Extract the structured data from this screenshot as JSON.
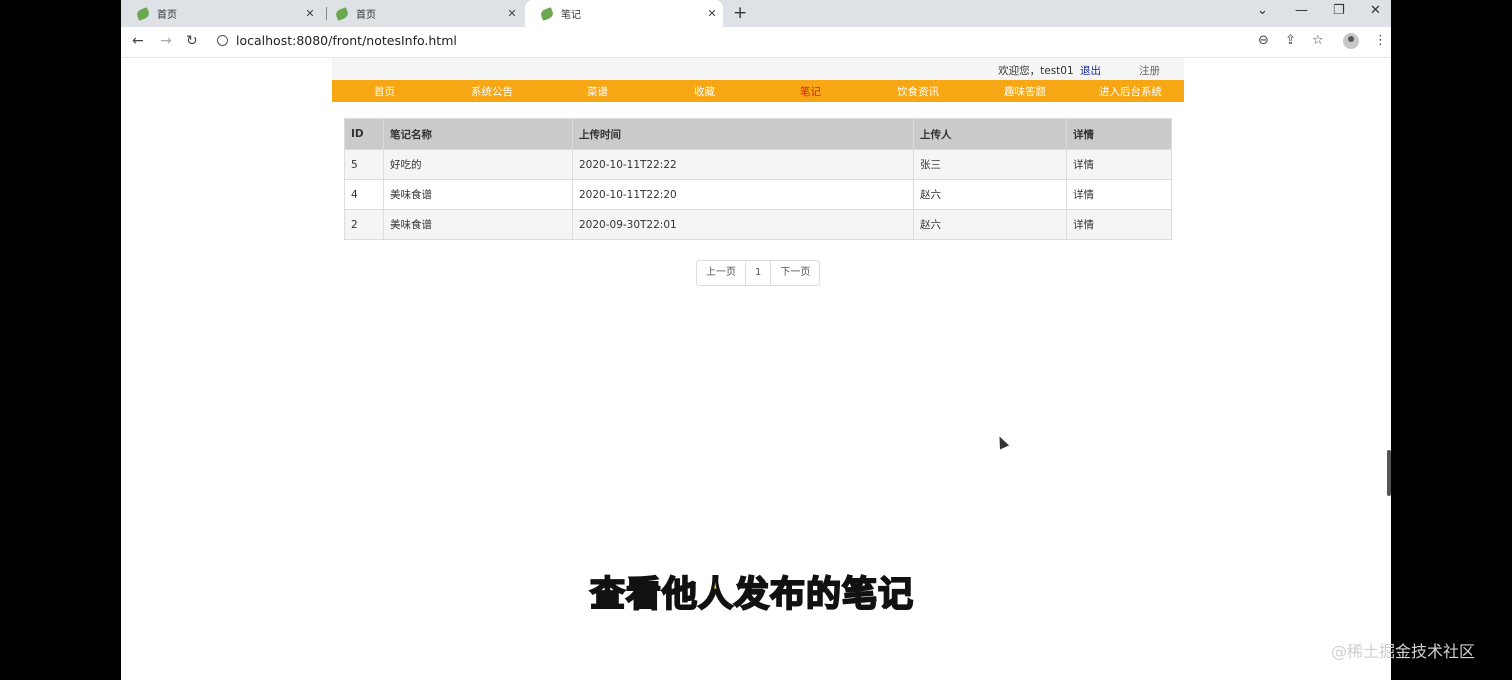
{
  "browser": {
    "tabs": [
      {
        "title": "首页",
        "active": false
      },
      {
        "title": "首页",
        "active": false
      },
      {
        "title": "笔记",
        "active": true
      }
    ],
    "url": "localhost:8080/front/notesInfo.html"
  },
  "header": {
    "welcome_text": "欢迎您，test01",
    "logout_label": "退出",
    "register_label": "注册"
  },
  "nav": {
    "items": [
      "首页",
      "系统公告",
      "菜谱",
      "收藏",
      "笔记",
      "饮食资讯",
      "趣味答题",
      "进入后台系统"
    ],
    "active_index": 4
  },
  "table": {
    "headers": [
      "ID",
      "笔记名称",
      "上传时间",
      "上传人",
      "详情"
    ],
    "rows": [
      [
        "5",
        "好吃的",
        "2020-10-11T22:22",
        "张三",
        "详情"
      ],
      [
        "4",
        "美味食谱",
        "2020-10-11T22:20",
        "赵六",
        "详情"
      ],
      [
        "2",
        "美味食谱",
        "2020-09-30T22:01",
        "赵六",
        "详情"
      ]
    ]
  },
  "pager": {
    "prev_label": "上一页",
    "page": "1",
    "next_label": "下一页"
  },
  "overlay": {
    "subtitle": "查看他人发布的笔记",
    "watermark": "@稀土掘金技术社区"
  },
  "colors": {
    "nav_bg": "#f7a614",
    "nav_active": "#d62020",
    "logout_link": "#1a2a9b",
    "subtitle_fill": "#f7e400"
  }
}
